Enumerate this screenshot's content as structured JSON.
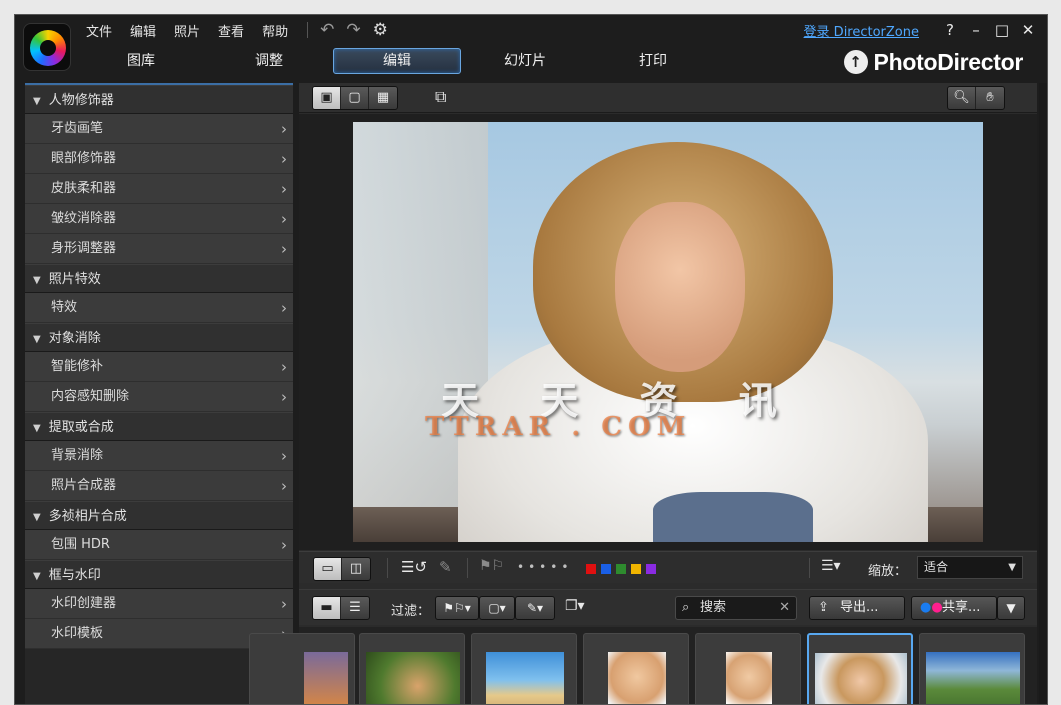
{
  "menu": [
    "文件",
    "编辑",
    "照片",
    "查看",
    "帮助"
  ],
  "top_right": {
    "login_link": "登录 DirectorZone",
    "help": "?",
    "minimize": "–",
    "maximize": "□",
    "close": "✕"
  },
  "modes": [
    "图库",
    "调整",
    "编辑",
    "幻灯片",
    "打印"
  ],
  "active_mode": "编辑",
  "brand": {
    "name": "PhotoDirector"
  },
  "left_panel": [
    {
      "title": "人物修饰器",
      "items": [
        "牙齿画笔",
        "眼部修饰器",
        "皮肤柔和器",
        "皱纹消除器",
        "身形调整器"
      ]
    },
    {
      "title": "照片特效",
      "items": [
        "特效"
      ]
    },
    {
      "title": "对象消除",
      "items": [
        "智能修补",
        "内容感知删除"
      ]
    },
    {
      "title": "提取或合成",
      "items": [
        "背景消除",
        "照片合成器"
      ]
    },
    {
      "title": "多祯相片合成",
      "items": [
        "包围 HDR"
      ]
    },
    {
      "title": "框与水印",
      "items": [
        "水印创建器",
        "水印模板"
      ]
    }
  ],
  "watermark": {
    "line1": "天 天 资 讯",
    "line2": "TTRAR . COM"
  },
  "edit_toolbar": {
    "zoom_label": "缩放：",
    "zoom_value": "适合",
    "color_labels": [
      "#e01010",
      "#1a5fe6",
      "#2e8b2e",
      "#f0b400",
      "#8a2be2"
    ]
  },
  "filter_bar": {
    "filter_label": "过滤：",
    "search_placeholder": "搜索",
    "export_label": "导出...",
    "share_label": "共享..."
  },
  "icons": {
    "close": "close-icon",
    "search": "search-icon",
    "hand": "hand-icon",
    "settings": "gear-icon"
  }
}
